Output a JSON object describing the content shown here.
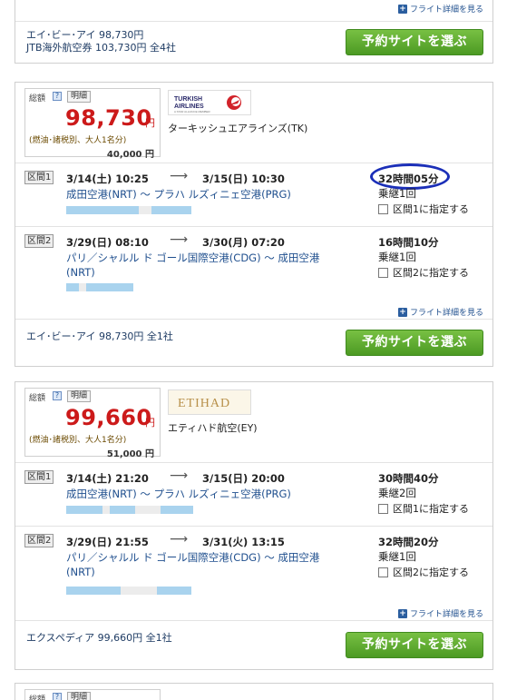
{
  "top_card": {
    "detail_link": "フライト詳細を見る",
    "agency_line1": "エイ･ビー･アイ 98,730円",
    "agency_line2": "JTB海外航空券 103,730円 全4社",
    "book_button": "予約サイトを選ぶ"
  },
  "results": [
    {
      "total_label": "総額",
      "help_icon": "?",
      "detail_tab": "明細",
      "price": "98,730",
      "yen": "円",
      "fuel_note": "(燃油･諸税別、大人1名分)",
      "base_price": "40,000 円",
      "logo_text": "TURKISH AIRLINES",
      "airline": "ターキッシュエアラインズ(TK)",
      "segments": [
        {
          "badge": "区間1",
          "dep": "3/14(土) 10:25",
          "arr": "3/15(日) 10:30",
          "route": "成田空港(NRT) 〜 プラハ ルズィニェ空港(PRG)",
          "duration": "32時間05分",
          "stops": "乗継1回",
          "designate": "区間1に指定する"
        },
        {
          "badge": "区間2",
          "dep": "3/29(日) 08:10",
          "arr": "3/30(月) 07:20",
          "route": "パリ／シャルル ド ゴール国際空港(CDG) 〜 成田空港(NRT)",
          "duration": "16時間10分",
          "stops": "乗継1回",
          "designate": "区間2に指定する"
        }
      ],
      "detail_link": "フライト詳細を見る",
      "agency": "エイ･ビー･アイ 98,730円 全1社",
      "book_button": "予約サイトを選ぶ"
    },
    {
      "total_label": "総額",
      "help_icon": "?",
      "detail_tab": "明細",
      "price": "99,660",
      "yen": "円",
      "fuel_note": "(燃油･諸税別、大人1名分)",
      "base_price": "51,000 円",
      "logo_text": "ETIHAD",
      "airline": "エティハド航空(EY)",
      "segments": [
        {
          "badge": "区間1",
          "dep": "3/14(土) 21:20",
          "arr": "3/15(日) 20:00",
          "route": "成田空港(NRT) 〜 プラハ ルズィニェ空港(PRG)",
          "duration": "30時間40分",
          "stops": "乗継2回",
          "designate": "区間1に指定する"
        },
        {
          "badge": "区間2",
          "dep": "3/29(日) 21:55",
          "arr": "3/31(火) 13:15",
          "route": "パリ／シャルル ド ゴール国際空港(CDG) 〜 成田空港(NRT)",
          "duration": "32時間20分",
          "stops": "乗継1回",
          "designate": "区間2に指定する"
        }
      ],
      "detail_link": "フライト詳細を見る",
      "agency": "エクスペディア 99,660円 全1社",
      "book_button": "予約サイトを選ぶ"
    }
  ],
  "bottom_card": {
    "total_label": "総額",
    "help_icon": "?",
    "detail_tab": "明細"
  },
  "colors": {
    "price_red": "#cc1a1a",
    "link_blue": "#1f4f8e",
    "button_green": "#5aa82d",
    "highlight_ring": "#1b2fb8"
  }
}
